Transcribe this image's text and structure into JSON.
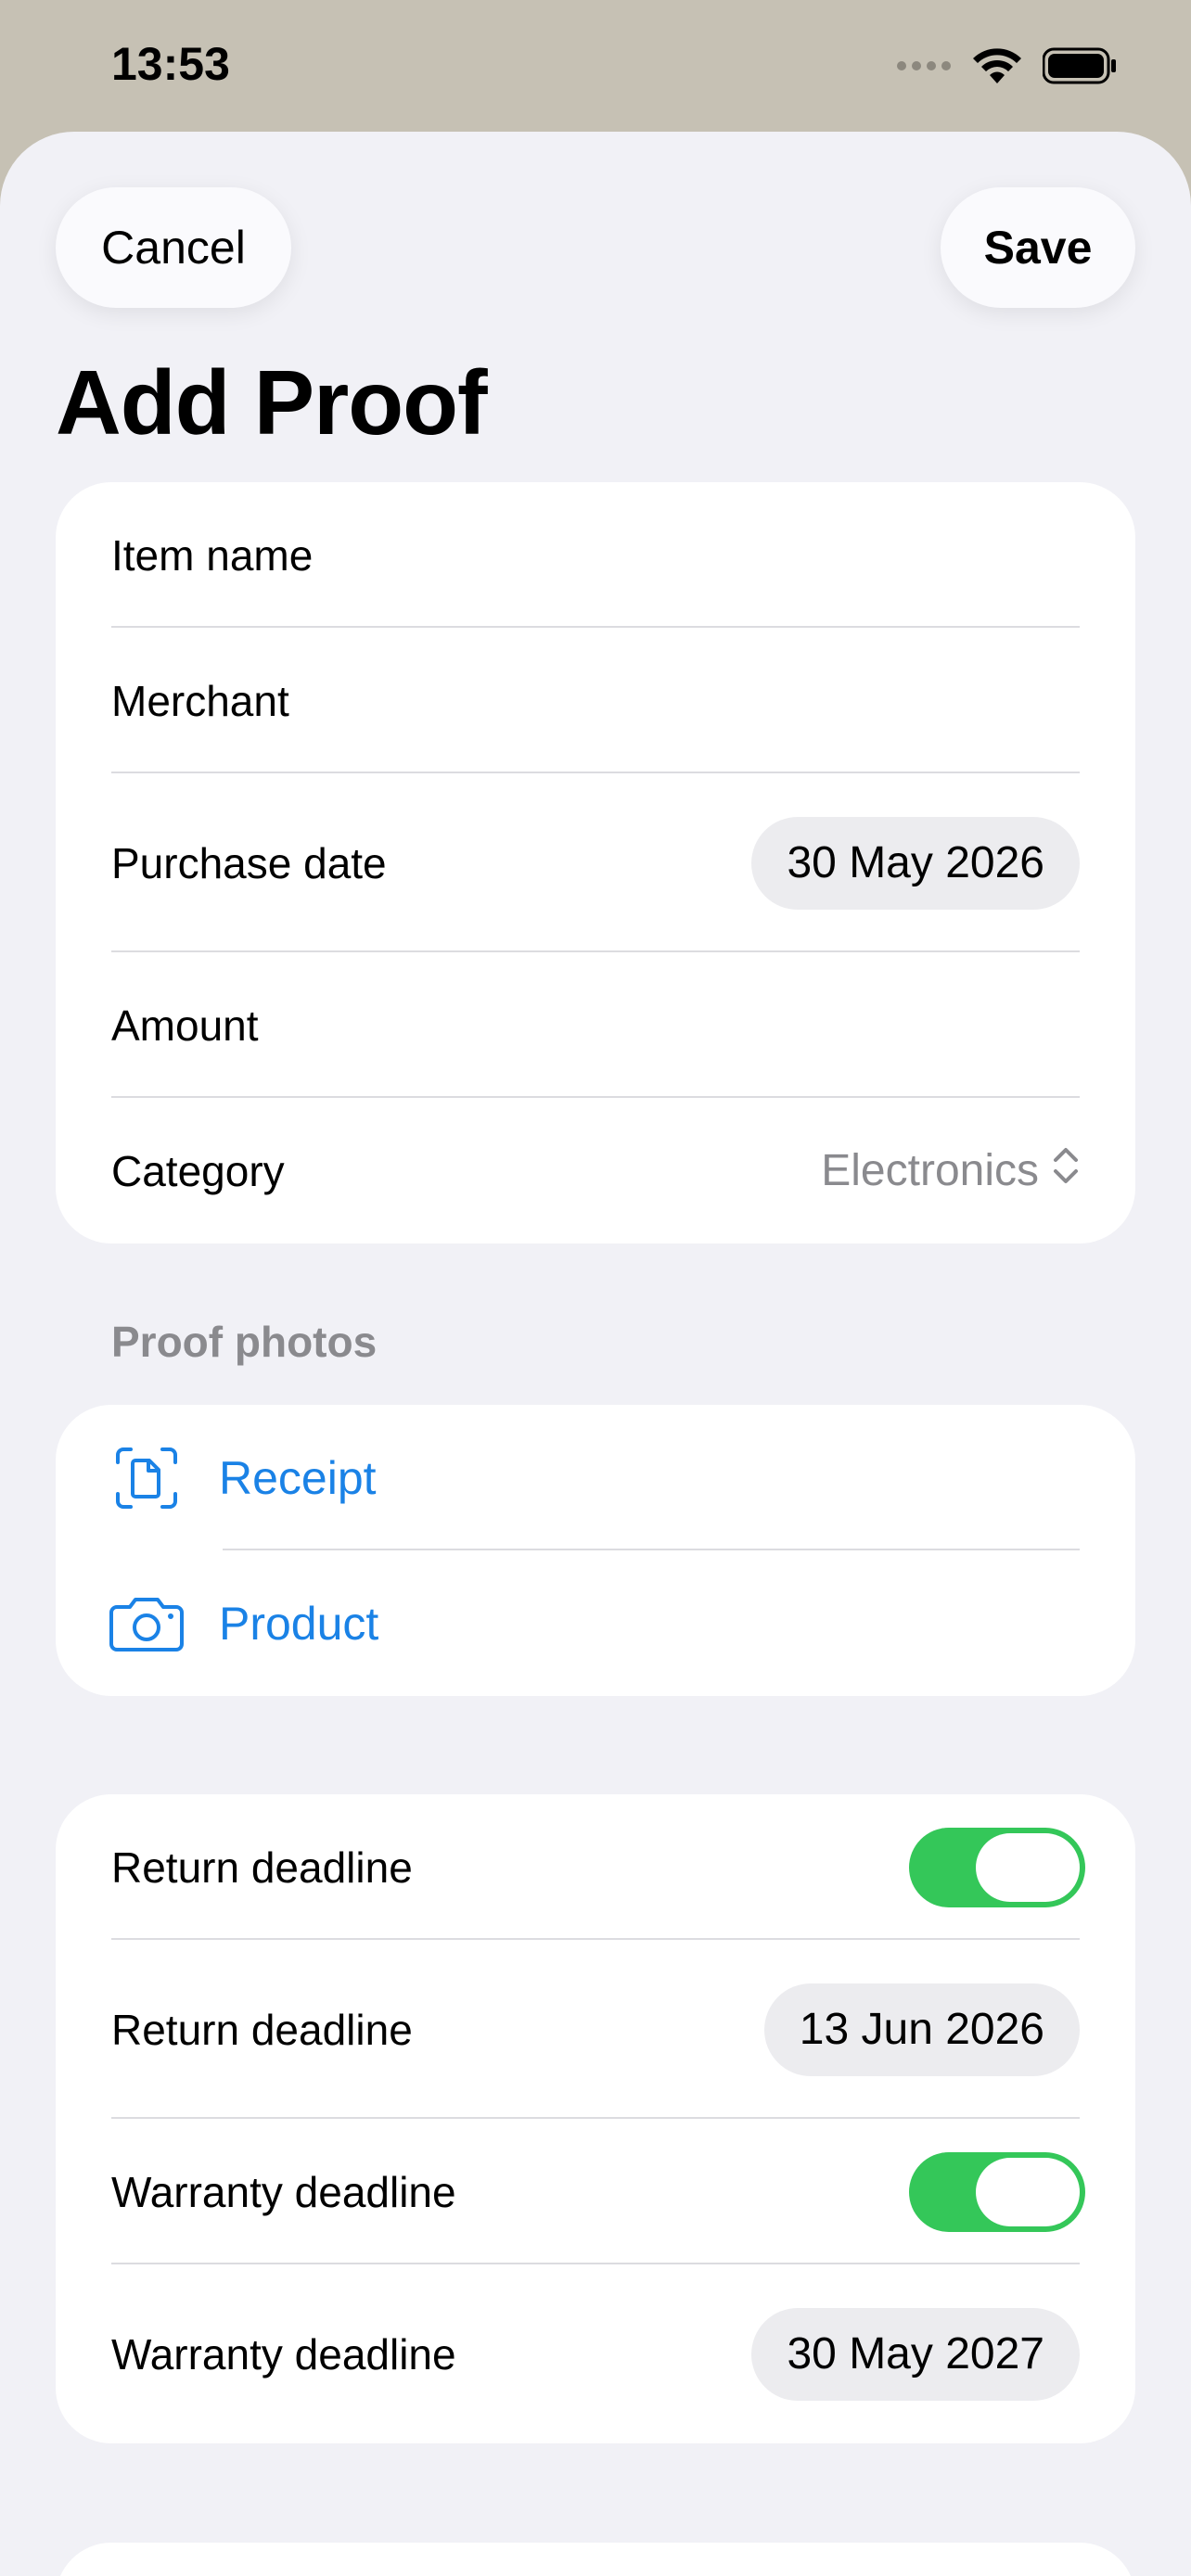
{
  "status": {
    "time": "13:53"
  },
  "nav": {
    "cancel": "Cancel",
    "save": "Save"
  },
  "title": "Add Proof",
  "fields": {
    "item_name_placeholder": "Item name",
    "merchant_placeholder": "Merchant",
    "purchase_date_label": "Purchase date",
    "purchase_date_value": "30 May 2026",
    "amount_placeholder": "Amount",
    "category_label": "Category",
    "category_value": "Electronics"
  },
  "proof_photos": {
    "header": "Proof photos",
    "items": [
      {
        "label": "Receipt",
        "icon": "doc-scan-icon"
      },
      {
        "label": "Product",
        "icon": "camera-icon"
      }
    ]
  },
  "deadlines": {
    "return_toggle_label": "Return deadline",
    "return_toggle_on": true,
    "return_date_label": "Return deadline",
    "return_date_value": "13 Jun 2026",
    "warranty_toggle_label": "Warranty deadline",
    "warranty_toggle_on": true,
    "warranty_date_label": "Warranty deadline",
    "warranty_date_value": "30 May 2027"
  },
  "colors": {
    "accent": "#1a82e6",
    "toggle_on": "#34c759",
    "background": "#f1f1f6",
    "status_bar": "#c6c1b4"
  }
}
